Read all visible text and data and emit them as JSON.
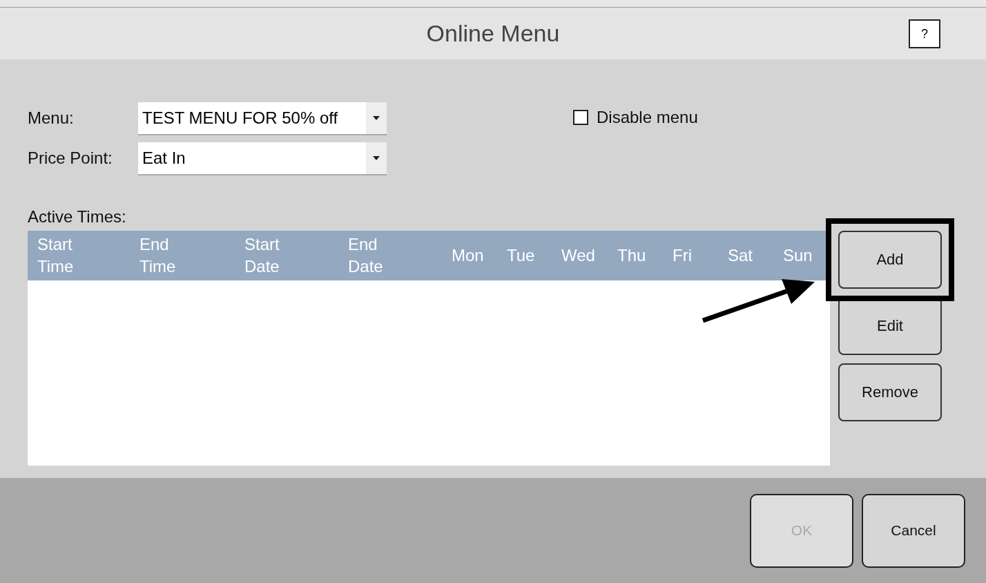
{
  "window": {
    "title": "Online Menu",
    "help": "?"
  },
  "fields": [
    {
      "label": "Menu:",
      "value": "TEST MENU FOR 50% off"
    },
    {
      "label": "Price Point:",
      "value": "Eat In"
    }
  ],
  "disable_menu": {
    "label": "Disable menu",
    "checked": false
  },
  "active_times": {
    "label": "Active Times:",
    "columns": [
      "Start Time",
      "End Time",
      "Start Date",
      "End Date",
      "Mon",
      "Tue",
      "Wed",
      "Thu",
      "Fri",
      "Sat",
      "Sun"
    ]
  },
  "side_buttons": [
    {
      "label": "Add",
      "highlighted": true
    },
    {
      "label": "Edit",
      "highlighted": false
    },
    {
      "label": "Remove",
      "highlighted": false
    }
  ],
  "footer_buttons": [
    {
      "label": "OK",
      "disabled": true
    },
    {
      "label": "Cancel",
      "disabled": false
    }
  ]
}
